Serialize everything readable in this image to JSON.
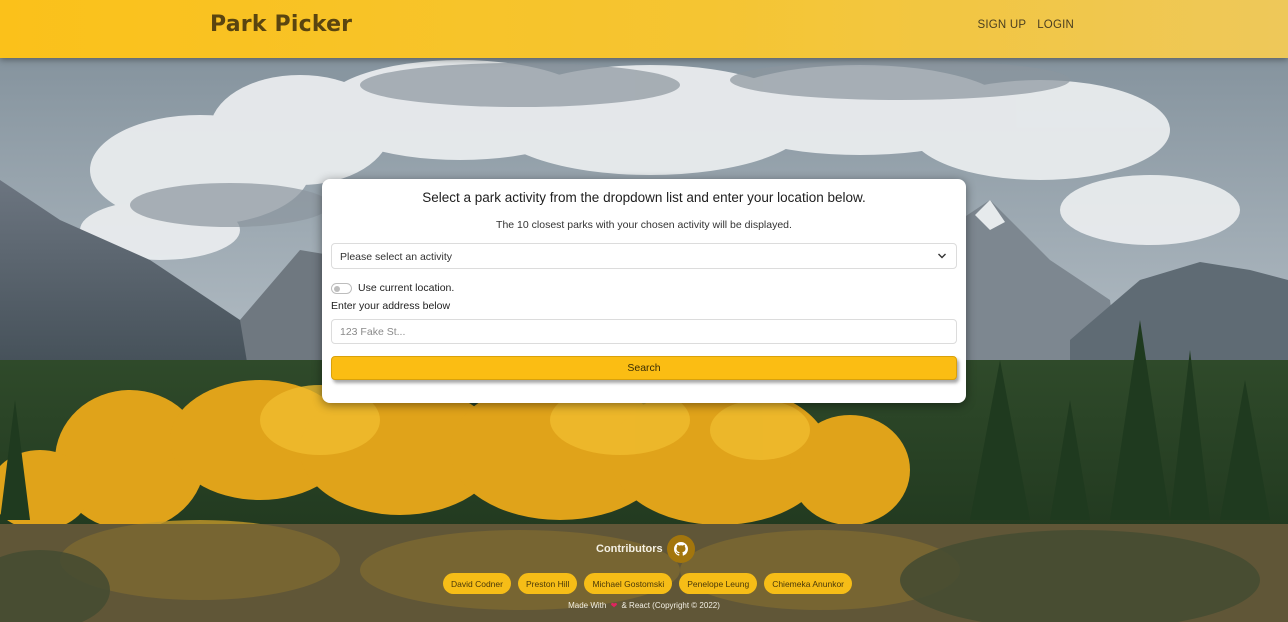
{
  "navbar": {
    "brand": "Park Picker",
    "links": [
      "SIGN UP",
      "LOGIN"
    ]
  },
  "search_card": {
    "title": "Select a park activity from the dropdown list and enter your location below.",
    "subtitle": "The 10 closest parks with your chosen activity will be displayed.",
    "activity_select": "Please select an activity",
    "toggle_label": "Use current location.",
    "toggle_on": false,
    "address_label": "Enter your address below",
    "address_placeholder": "123 Fake St...",
    "address_value": "",
    "search_label": "Search"
  },
  "footer": {
    "contributors_label": "Contributors",
    "contributors": [
      "David Codner",
      "Preston Hill",
      "Michael Gostomski",
      "Penelope Leung",
      "Chiemeka Anunkor"
    ],
    "made_with_prefix": "Made With",
    "made_with_suffix": "& React (Copyright © 2022)"
  },
  "icons": {
    "dropdown": "chevron-down-icon",
    "github": "github-icon",
    "heart": "heart-icon"
  },
  "colors": {
    "accent": "#fbbd13",
    "brand_text": "#5a4510"
  }
}
